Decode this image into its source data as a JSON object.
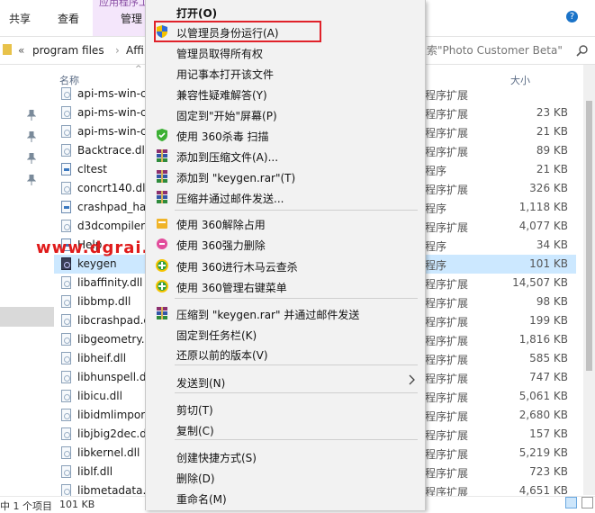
{
  "ribbon": {
    "tabs": [
      "共享",
      "查看",
      "管理"
    ],
    "context_tab": "应用程序工具",
    "help": "?"
  },
  "address": {
    "overflow": "«",
    "crumbs": [
      "program files",
      "Affi"
    ],
    "search_placeholder": "搜索\"Photo Customer Beta\""
  },
  "columns": {
    "name": "名称",
    "size": "大小"
  },
  "files": [
    {
      "name": "api-ms-win-c",
      "type": "程序扩展",
      "size": "",
      "icon": "file-icon"
    },
    {
      "name": "api-ms-win-cr",
      "type": "程序扩展",
      "size": "23 KB",
      "icon": "file-icon"
    },
    {
      "name": "api-ms-win-cr",
      "type": "程序扩展",
      "size": "21 KB",
      "icon": "file-icon"
    },
    {
      "name": "Backtrace.dll",
      "type": "程序扩展",
      "size": "89 KB",
      "icon": "file-icon"
    },
    {
      "name": "cltest",
      "type": "程序",
      "size": "21 KB",
      "icon": "exe-icon"
    },
    {
      "name": "concrt140.dll",
      "type": "程序扩展",
      "size": "326 KB",
      "icon": "file-icon"
    },
    {
      "name": "crashpad_ha",
      "type": "程序",
      "size": "1,118 KB",
      "icon": "exe-icon"
    },
    {
      "name": "d3dcompiler",
      "type": "程序扩展",
      "size": "4,077 KB",
      "icon": "file-icon"
    },
    {
      "name": "Help",
      "type": "程序",
      "size": "34 KB",
      "icon": "exe-icon"
    },
    {
      "name": "keygen",
      "type": "程序",
      "size": "101 KB",
      "icon": "keygen-icon",
      "selected": true
    },
    {
      "name": "libaffinity.dll",
      "type": "程序扩展",
      "size": "14,507 KB",
      "icon": "file-icon"
    },
    {
      "name": "libbmp.dll",
      "type": "程序扩展",
      "size": "98 KB",
      "icon": "file-icon"
    },
    {
      "name": "libcrashpad.c",
      "type": "程序扩展",
      "size": "199 KB",
      "icon": "file-icon"
    },
    {
      "name": "libgeometry.",
      "type": "程序扩展",
      "size": "1,816 KB",
      "icon": "file-icon"
    },
    {
      "name": "libheif.dll",
      "type": "程序扩展",
      "size": "585 KB",
      "icon": "file-icon"
    },
    {
      "name": "libhunspell.d",
      "type": "程序扩展",
      "size": "747 KB",
      "icon": "file-icon"
    },
    {
      "name": "libicu.dll",
      "type": "程序扩展",
      "size": "5,061 KB",
      "icon": "file-icon"
    },
    {
      "name": "libidmlimpor",
      "type": "程序扩展",
      "size": "2,680 KB",
      "icon": "file-icon"
    },
    {
      "name": "libjbig2dec.d",
      "type": "程序扩展",
      "size": "157 KB",
      "icon": "file-icon"
    },
    {
      "name": "libkernel.dll",
      "type": "程序扩展",
      "size": "5,219 KB",
      "icon": "file-icon"
    },
    {
      "name": "liblf.dll",
      "type": "程序扩展",
      "size": "723 KB",
      "icon": "file-icon"
    },
    {
      "name": "libmetadata.",
      "type": "程序扩展",
      "size": "4,651 KB",
      "icon": "file-icon"
    }
  ],
  "status": {
    "selected": "中 1 个项目",
    "size": "101 KB"
  },
  "watermark": "www.dgrai.com",
  "menu": {
    "items": [
      {
        "label": "打开(O)",
        "icon": "",
        "bold": true
      },
      {
        "label": "以管理员身份运行(A)",
        "icon": "uac-shield-icon"
      },
      {
        "label": "管理员取得所有权",
        "icon": ""
      },
      {
        "label": "用记事本打开该文件",
        "icon": ""
      },
      {
        "label": "兼容性疑难解答(Y)",
        "icon": ""
      },
      {
        "label": "固定到\"开始\"屏幕(P)",
        "icon": ""
      },
      {
        "label": "使用 360杀毒 扫描",
        "icon": "360-antivirus-icon"
      },
      {
        "label": "添加到压缩文件(A)...",
        "icon": "winrar-icon"
      },
      {
        "label": "添加到 \"keygen.rar\"(T)",
        "icon": "winrar-icon"
      },
      {
        "label": "压缩并通过邮件发送...",
        "icon": "winrar-icon"
      },
      {
        "label": "使用 360解除占用",
        "icon": "360-unlock-icon"
      },
      {
        "label": "使用 360强力删除",
        "icon": "360-shred-icon"
      },
      {
        "label": "使用 360进行木马云查杀",
        "icon": "360-plus-icon"
      },
      {
        "label": "使用 360管理右键菜单",
        "icon": "360-plus-icon"
      },
      {
        "label": "压缩到 \"keygen.rar\" 并通过邮件发送",
        "icon": "winrar-icon"
      },
      {
        "label": "固定到任务栏(K)",
        "icon": ""
      },
      {
        "label": "还原以前的版本(V)",
        "icon": ""
      },
      {
        "label": "发送到(N)",
        "icon": "",
        "submenu": true
      },
      {
        "label": "剪切(T)",
        "icon": ""
      },
      {
        "label": "复制(C)",
        "icon": ""
      },
      {
        "label": "创建快捷方式(S)",
        "icon": ""
      },
      {
        "label": "删除(D)",
        "icon": ""
      },
      {
        "label": "重命名(M)",
        "icon": ""
      }
    ]
  },
  "colors": {
    "highlight_border": "#e0222a",
    "selected_row": "#cce8ff",
    "context_tab_bg": "#f4e6fb",
    "watermark": "#e01b1b"
  }
}
